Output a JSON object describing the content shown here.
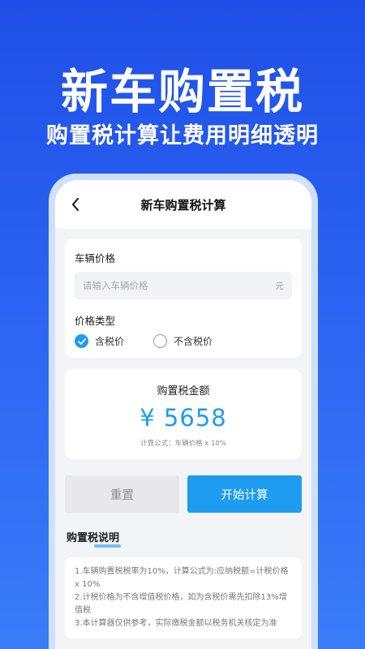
{
  "promo": {
    "title": "新车购置税",
    "subtitle": "购置税计算让费用明细透明"
  },
  "nav": {
    "back_icon": "chevron-left-icon",
    "title": "新车购置税计算"
  },
  "form": {
    "price_label": "车辆价格",
    "price_placeholder": "请输入车辆价格",
    "price_value": "",
    "unit": "元",
    "type_label": "价格类型",
    "options": [
      {
        "label": "含税价",
        "checked": true
      },
      {
        "label": "不含税价",
        "checked": false
      }
    ]
  },
  "result": {
    "title": "购置税金额",
    "amount": "¥ 5658",
    "formula": "计算公式：车辆价格 x 10%"
  },
  "buttons": {
    "reset": "重置",
    "calculate": "开始计算"
  },
  "info": {
    "title": "购置税说明",
    "lines": [
      "1.车辆购置税税率为10%，计算公式为:应纳税额=计税价格 x 10%",
      "2.计税价格为不含增值税价格，如为含税价需先扣除13%增值税",
      "3.本计算器仅供参考，实际缴税金额以税务机关核定为准"
    ]
  },
  "colors": {
    "accent": "#1e9cf0",
    "background_top": "#1f4fe6",
    "background_bottom": "#3a7cf8",
    "phone_frame": "#cfe0ff"
  }
}
